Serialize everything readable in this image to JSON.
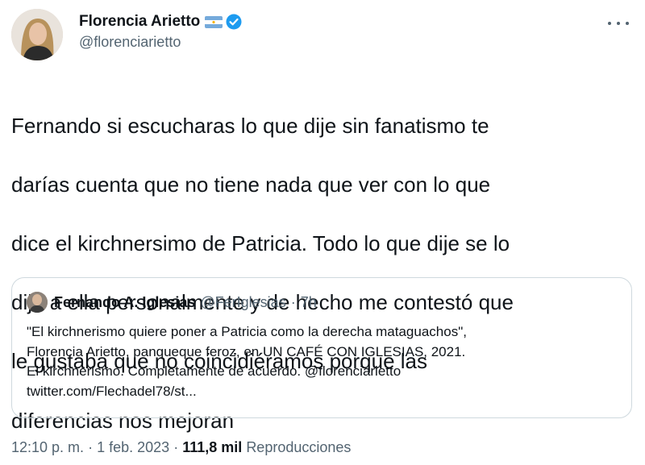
{
  "author": {
    "name": "Florencia Arietto",
    "handle": "@florenciarietto",
    "flag_icon": "argentina-flag-icon",
    "verified_icon": "verified-badge-icon"
  },
  "tweet": {
    "text_lines": [
      "Fernando si escucharas lo que dije sin fanatismo te",
      "darías cuenta que no tiene nada que ver con lo que",
      "dice el kirchnersimo de Patricia. Todo lo que dije se lo",
      "dije a ella personalmente y de hecho me contestó que",
      "le gustaba que no coincidiéramos porque las",
      "diferencias nos mejoran"
    ]
  },
  "quote": {
    "name": "Fernando A. Iglesias",
    "handle": "@FerIglesias",
    "separator": "·",
    "time": "7h",
    "lines": [
      "\"El kirchnerismo quiere poner a Patricia como la derecha mataguachos\",",
      "Florencia Arietto, panqueque feroz, en UN CAFÉ CON IGLESIAS, 2021.",
      "El kirchnerismo. Completamente de acuerdo. @florenciarietto",
      "twitter.com/Flechadel78/st..."
    ]
  },
  "meta": {
    "time": "12:10 p. m.",
    "sep1": "·",
    "date": "1 feb. 2023",
    "sep2": "·",
    "views_count": "111,8 mil",
    "views_label": "Reproducciones"
  },
  "colors": {
    "text": "#0f1419",
    "secondary": "#536471",
    "border": "#cfd9de",
    "verified": "#1d9bf0"
  }
}
